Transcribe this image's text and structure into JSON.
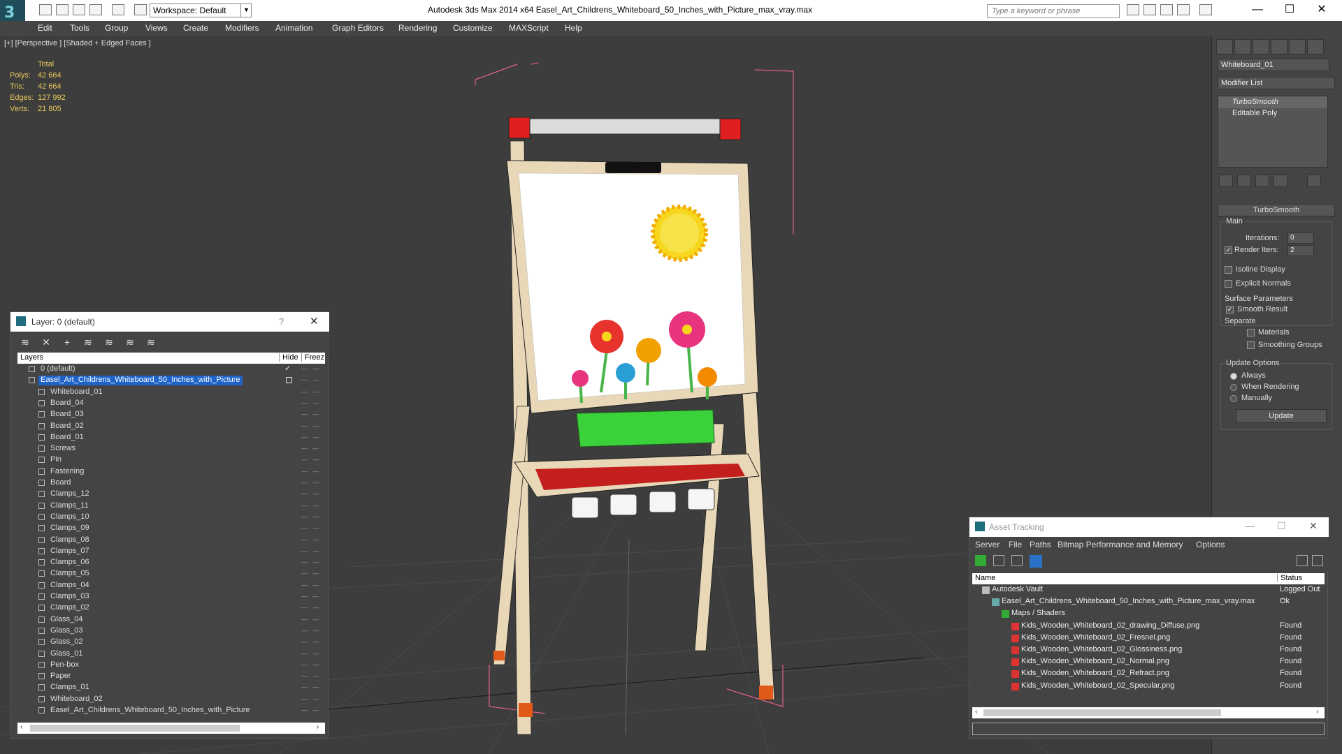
{
  "app": {
    "title": "Autodesk 3ds Max  2014 x64      Easel_Art_Childrens_Whiteboard_50_Inches_with_Picture_max_vray.max",
    "workspace": "Workspace: Default",
    "search_placeholder": "Type a keyword or phrase"
  },
  "menu": [
    "Edit",
    "Tools",
    "Group",
    "Views",
    "Create",
    "Modifiers",
    "Animation",
    "Graph Editors",
    "Rendering",
    "Customize",
    "MAXScript",
    "Help"
  ],
  "viewport": {
    "label": "[+] [Perspective ] [Shaded + Edged Faces ]",
    "stats": {
      "header": "Total",
      "rows": [
        {
          "label": "Polys:",
          "value": "42 664"
        },
        {
          "label": "Tris:",
          "value": "42 664"
        },
        {
          "label": "Edges:",
          "value": "127 992"
        },
        {
          "label": "Verts:",
          "value": "21 805"
        }
      ]
    }
  },
  "command_panel": {
    "object_name": "Whiteboard_01",
    "modifier_list": "Modifier List",
    "stack": [
      "TurboSmooth",
      "Editable Poly"
    ],
    "rollout_title": "TurboSmooth",
    "main_label": "Main",
    "iterations_label": "Iterations:",
    "iterations_value": "0",
    "render_iters_label": "Render Iters:",
    "render_iters_value": "2",
    "isoline": "Isoline Display",
    "explicit_normals": "Explicit Normals",
    "surface_params": "Surface Parameters",
    "smooth_result": "Smooth Result",
    "separate": "Separate",
    "materials": "Materials",
    "smoothing_groups": "Smoothing Groups",
    "update_options": "Update Options",
    "always": "Always",
    "when_rendering": "When Rendering",
    "manually": "Manually",
    "update_button": "Update"
  },
  "layer_panel": {
    "title": "Layer: 0 (default)",
    "help": "?",
    "columns": [
      "Layers",
      "Hide",
      "Freez"
    ],
    "rows": [
      {
        "name": "0 (default)",
        "level": 1
      },
      {
        "name": "Easel_Art_Childrens_Whiteboard_50_Inches_with_Picture",
        "level": 1,
        "selected": true
      },
      {
        "name": "Whiteboard_01",
        "level": 2
      },
      {
        "name": "Board_04",
        "level": 2
      },
      {
        "name": "Board_03",
        "level": 2
      },
      {
        "name": "Board_02",
        "level": 2
      },
      {
        "name": "Board_01",
        "level": 2
      },
      {
        "name": "Screws",
        "level": 2
      },
      {
        "name": "Pin",
        "level": 2
      },
      {
        "name": "Fastening",
        "level": 2
      },
      {
        "name": "Board",
        "level": 2
      },
      {
        "name": "Clamps_12",
        "level": 2
      },
      {
        "name": "Clamps_11",
        "level": 2
      },
      {
        "name": "Clamps_10",
        "level": 2
      },
      {
        "name": "Clamps_09",
        "level": 2
      },
      {
        "name": "Clamps_08",
        "level": 2
      },
      {
        "name": "Clamps_07",
        "level": 2
      },
      {
        "name": "Clamps_06",
        "level": 2
      },
      {
        "name": "Clamps_05",
        "level": 2
      },
      {
        "name": "Clamps_04",
        "level": 2
      },
      {
        "name": "Clamps_03",
        "level": 2
      },
      {
        "name": "Clamps_02",
        "level": 2
      },
      {
        "name": "Glass_04",
        "level": 2
      },
      {
        "name": "Glass_03",
        "level": 2
      },
      {
        "name": "Glass_02",
        "level": 2
      },
      {
        "name": "Glass_01",
        "level": 2
      },
      {
        "name": "Pen-box",
        "level": 2
      },
      {
        "name": "Paper",
        "level": 2
      },
      {
        "name": "Clamps_01",
        "level": 2
      },
      {
        "name": "Whiteboard_02",
        "level": 2
      },
      {
        "name": "Easel_Art_Childrens_Whiteboard_50_Inches_with_Picture",
        "level": 2
      }
    ]
  },
  "asset_panel": {
    "title": "Asset Tracking",
    "menu": [
      "Server",
      "File",
      "Paths",
      "Bitmap Performance and Memory",
      "Options"
    ],
    "columns": [
      "Name",
      "Status"
    ],
    "rows": [
      {
        "name": "Autodesk Vault",
        "status": "Logged Out ...",
        "level": 1,
        "icon": "vault-icon"
      },
      {
        "name": "Easel_Art_Childrens_Whiteboard_50_Inches_with_Picture_max_vray.max",
        "status": "Ok",
        "level": 2,
        "icon": "max-file-icon"
      },
      {
        "name": "Maps / Shaders",
        "status": "",
        "level": 3,
        "icon": "maps-icon"
      },
      {
        "name": "Kids_Wooden_Whiteboard_02_drawing_Diffuse.png",
        "status": "Found",
        "level": 4,
        "icon": "png-icon"
      },
      {
        "name": "Kids_Wooden_Whiteboard_02_Fresnel.png",
        "status": "Found",
        "level": 4,
        "icon": "png-icon"
      },
      {
        "name": "Kids_Wooden_Whiteboard_02_Glossiness.png",
        "status": "Found",
        "level": 4,
        "icon": "png-icon"
      },
      {
        "name": "Kids_Wooden_Whiteboard_02_Normal.png",
        "status": "Found",
        "level": 4,
        "icon": "png-icon"
      },
      {
        "name": "Kids_Wooden_Whiteboard_02_Refract.png",
        "status": "Found",
        "level": 4,
        "icon": "png-icon"
      },
      {
        "name": "Kids_Wooden_Whiteboard_02_Specular.png",
        "status": "Found",
        "level": 4,
        "icon": "png-icon"
      }
    ]
  },
  "colors": {
    "accent": "#1e64c8",
    "stats": "#e8c95a",
    "viewport_bg": "#3d3d3d"
  }
}
